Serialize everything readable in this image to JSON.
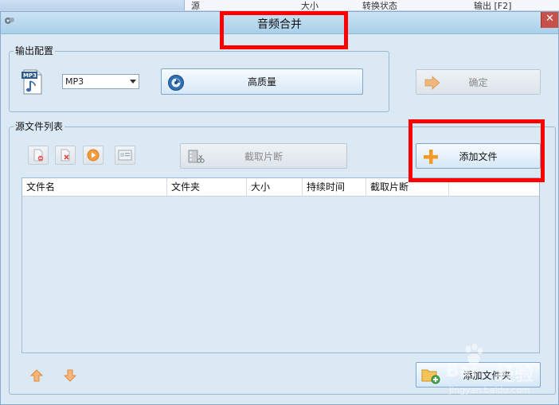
{
  "background_app": {
    "columns": [
      "源",
      "大小",
      "转换状态",
      "输出 [F2]"
    ]
  },
  "dialog": {
    "title": "音频合并",
    "close_symbol": "✕"
  },
  "output_config": {
    "group_label": "输出配置",
    "format_value": "MP3",
    "quality_button": "高质量",
    "confirm_button": "确定"
  },
  "source_list": {
    "group_label": "源文件列表",
    "clip_button": "截取片断",
    "add_file_button": "添加文件",
    "add_folder_button": "添加文件夹",
    "columns": [
      "文件名",
      "文件夹",
      "大小",
      "持续时间",
      "截取片断"
    ],
    "rows": []
  },
  "watermark": {
    "brand": "Bai",
    "brand_cn": "经验",
    "url": "jingyan.baidu.com"
  },
  "colors": {
    "accent": "#ff0000",
    "window_bg": "#dbe9f4",
    "titlebar": "#a9d0ea"
  }
}
